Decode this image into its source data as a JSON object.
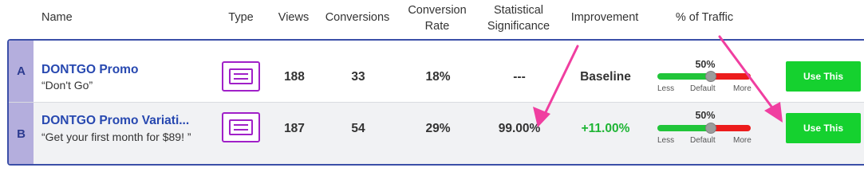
{
  "header": {
    "name": "Name",
    "type": "Type",
    "views": "Views",
    "conversions": "Conversions",
    "conversion_rate": "Conversion\nRate",
    "significance": "Statistical\nSignificance",
    "improvement": "Improvement",
    "traffic": "% of Traffic"
  },
  "rows": [
    {
      "letter": "A",
      "name": "DONTGO Promo",
      "subtitle": "“Don't Go”",
      "type_icon": "page-variation-icon",
      "views": "188",
      "conversions": "33",
      "conversion_rate": "18%",
      "significance": "---",
      "improvement": "Baseline",
      "traffic_pct": "50%",
      "traffic_value": 0.5,
      "slider_less": "Less",
      "slider_default": "Default",
      "slider_more": "More",
      "button": "Use This"
    },
    {
      "letter": "B",
      "name": "DONTGO Promo Variati...",
      "subtitle": "“Get your first month for $89! ”",
      "type_icon": "page-variation-icon",
      "views": "187",
      "conversions": "54",
      "conversion_rate": "29%",
      "significance": "99.00%",
      "improvement": "+11.00%",
      "traffic_pct": "50%",
      "traffic_value": 0.5,
      "slider_less": "Less",
      "slider_default": "Default",
      "slider_more": "More",
      "button": "Use This"
    }
  ],
  "colors": {
    "accent_blue": "#2748b0",
    "letter_column": "#b4aedd",
    "button_green": "#15d12f",
    "improvement_green": "#1fb535",
    "annotation_arrow": "#f03ea0"
  }
}
